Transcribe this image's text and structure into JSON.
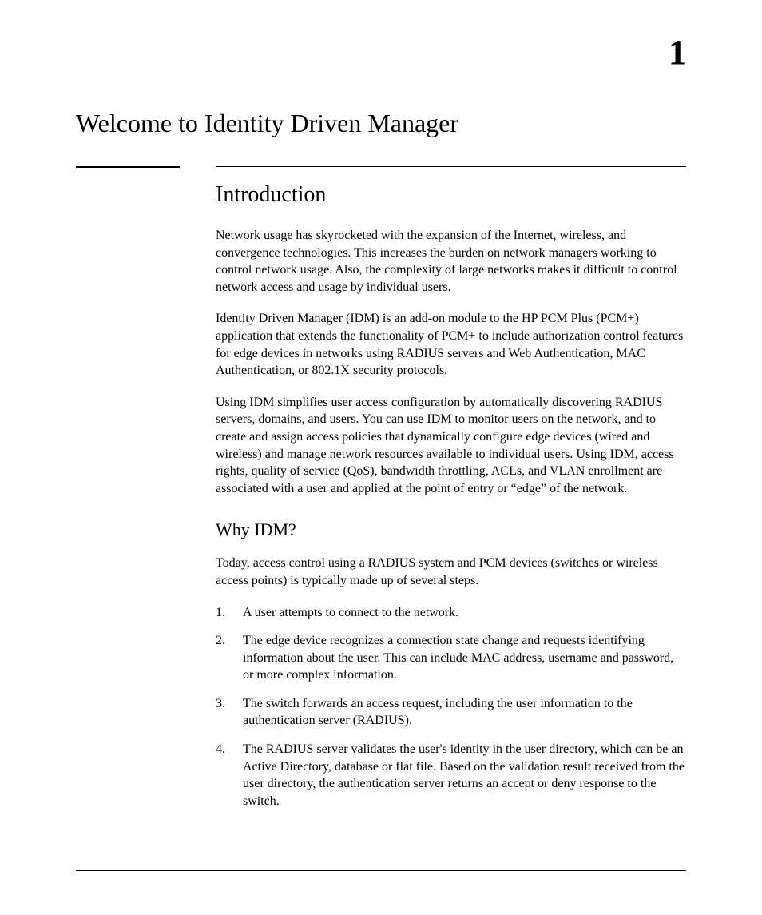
{
  "chapter_number": "1",
  "chapter_title": "Welcome to Identity Driven Manager",
  "section_title": "Introduction",
  "para1": "Network usage has skyrocketed with the expansion of the Internet, wireless, and convergence technologies. This increases the burden on network managers working to control network usage. Also, the complexity of large networks makes it difficult to control network access and usage by individual users.",
  "para2": "Identity Driven Manager (IDM) is an add-on module to the HP PCM Plus (PCM+) application that extends the functionality of PCM+ to include authorization control features for edge devices in networks using RADIUS servers and Web Authentication, MAC Authentication, or 802.1X security protocols.",
  "para3": "Using IDM simplifies user access configuration by automatically discovering RADIUS servers, domains, and users. You can use IDM to monitor users on the network, and to create and assign access policies that dynamically configure edge devices (wired and wireless) and manage network resources available to individual users. Using IDM, access rights, quality of service (QoS), bandwidth throttling, ACLs, and VLAN enrollment are associated with a user and applied at the point of entry or “edge” of the network.",
  "subsection_title": "Why IDM?",
  "para4": "Today, access control using a RADIUS system and PCM devices (switches or wireless access points) is typically made up of several steps.",
  "list": {
    "n1": "1.",
    "t1": "A user attempts to connect to the network.",
    "n2": "2.",
    "t2": "The edge device recognizes a connection state change and requests identifying information about the user. This can include MAC address, username and password, or more complex information.",
    "n3": "3.",
    "t3": "The switch forwards an access request, including the user information to the authentication server (RADIUS).",
    "n4": "4.",
    "t4": "The RADIUS server validates the user's identity in the user directory, which can be an Active Directory, database or flat file. Based on the validation result received from the user directory, the authentication server returns an accept or deny response to the switch."
  }
}
